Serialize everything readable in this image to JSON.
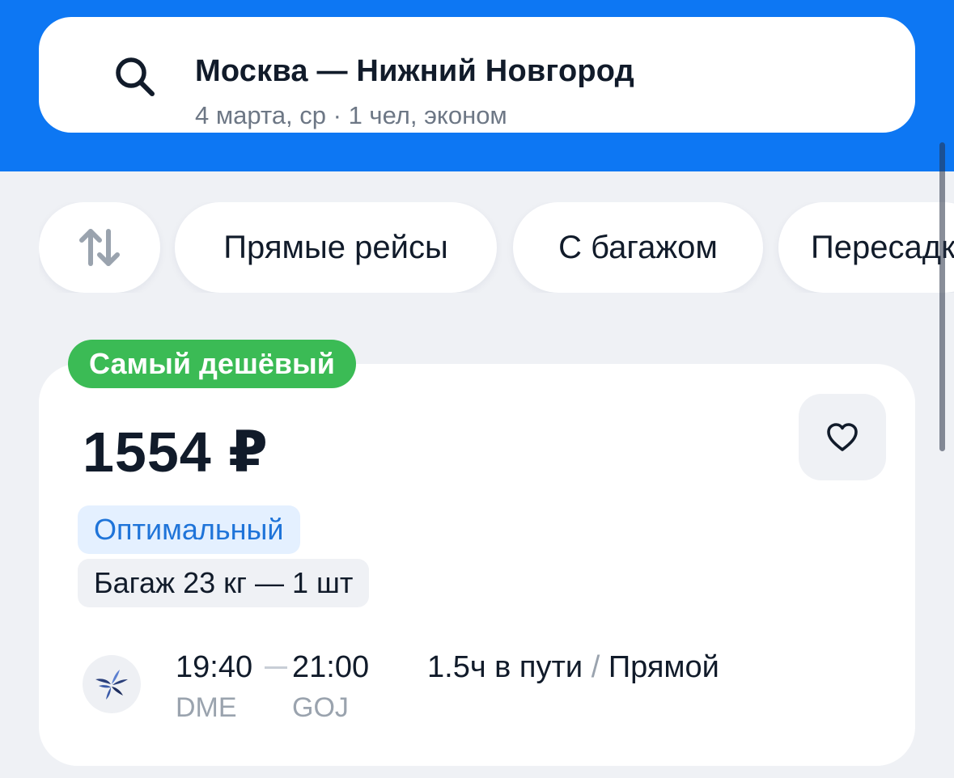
{
  "search": {
    "route": "Москва — Нижний Новгород",
    "details": "4 марта, ср · 1 чел, эконом",
    "icon": "search-icon"
  },
  "filters": [
    {
      "label": "",
      "icon": "sort-arrows-icon"
    },
    {
      "label": "Прямые рейсы"
    },
    {
      "label": "С багажом"
    },
    {
      "label": "Пересадки"
    }
  ],
  "offer": {
    "badge": "Самый дешёвый",
    "price": "1554 ₽",
    "tariff": "Оптимальный",
    "baggage": "Багаж 23 кг — 1 шт",
    "favorite_icon": "heart-icon",
    "flight": {
      "departure_time": "19:40",
      "arrival_time": "21:00",
      "departure_airport": "DME",
      "arrival_airport": "GOJ",
      "duration": "1.5ч в пути",
      "separator": "/",
      "type": "Прямой"
    }
  },
  "colors": {
    "header_blue": "#0d77f3",
    "badge_green": "#3bbb55",
    "tariff_blue": "#1f74d9",
    "background": "#eff1f5"
  }
}
